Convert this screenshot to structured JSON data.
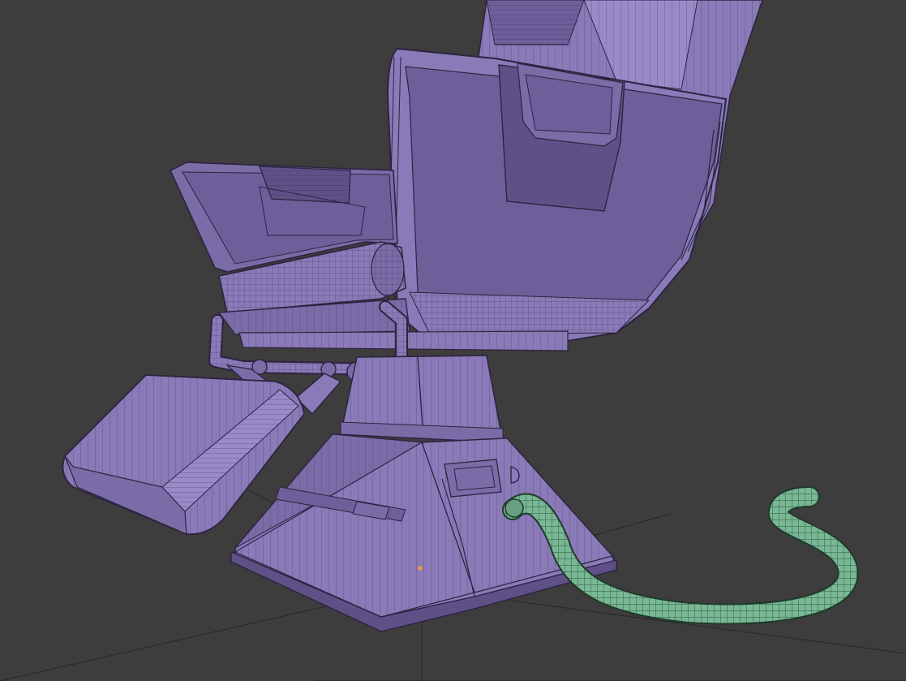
{
  "viewport": {
    "background": "#3d3d3d",
    "grid_color": "#2a2a2a"
  },
  "colors": {
    "mesh_face": "#8a7ab8",
    "mesh_face_dark": "#6e5f9a",
    "mesh_face_light": "#9a8ac8",
    "mesh_wire": "#2b2440",
    "cable_face": "#78b894",
    "cable_wire": "#1e3a2a",
    "origin_point": "#ff9a2a"
  },
  "objects": [
    {
      "name": "chair-backrest",
      "kind": "mesh"
    },
    {
      "name": "chair-seat",
      "kind": "mesh"
    },
    {
      "name": "chair-armrest",
      "kind": "mesh"
    },
    {
      "name": "chair-footrest",
      "kind": "mesh"
    },
    {
      "name": "chair-column",
      "kind": "mesh"
    },
    {
      "name": "chair-base",
      "kind": "mesh"
    },
    {
      "name": "power-cable",
      "kind": "curve",
      "selected": true
    }
  ]
}
